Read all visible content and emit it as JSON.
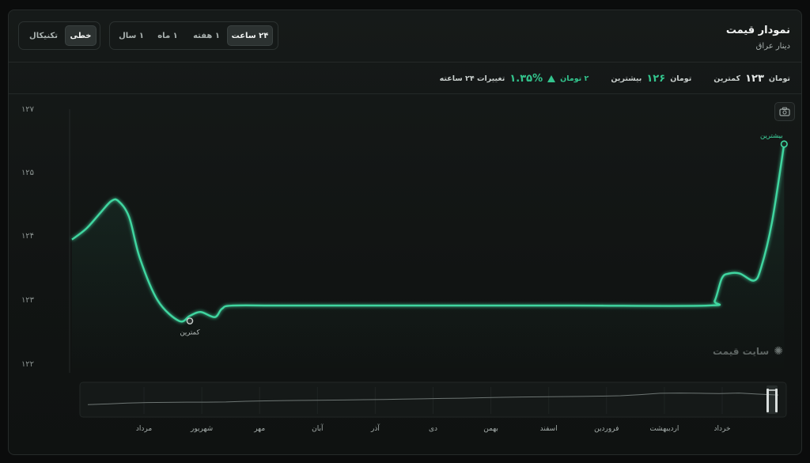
{
  "header": {
    "title": "نمودار قیمت",
    "subtitle": "دینار عراق"
  },
  "range_tabs": [
    {
      "label": "۲۴ ساعت",
      "active": true
    },
    {
      "label": "۱ هفته",
      "active": false
    },
    {
      "label": "۱ ماه",
      "active": false
    },
    {
      "label": "۱ سال",
      "active": false
    }
  ],
  "mode_tabs": [
    {
      "label": "خطی",
      "active": true
    },
    {
      "label": "تکنیکال",
      "active": false
    }
  ],
  "stats": {
    "change_label": "تغییرات ۲۴ ساعته",
    "change_percent": "۱.۳۵%",
    "change_amount": "۲ تومان",
    "max_label": "بیشترین",
    "max_value": "۱۲۶",
    "max_unit": "تومان",
    "min_label": "کمترین",
    "min_value": "۱۲۳",
    "min_unit": "تومان"
  },
  "watermark": "سایت قیمت",
  "icons": {
    "camera": "camera-icon",
    "logo": "logo-icon",
    "change_arrow": "triangle-up-icon"
  },
  "colors": {
    "line": "#3fd6a0",
    "accent_green": "#33c48d",
    "background": "#111413"
  },
  "chart_data": {
    "type": "area",
    "title": "",
    "xlabel": "",
    "ylabel": "",
    "ylim": [
      122,
      127
    ],
    "y_ticks": [
      122,
      123,
      124,
      125,
      127
    ],
    "y_tick_labels": [
      "۱۲۲",
      "۱۲۳",
      "۱۲۴",
      "۱۲۵",
      "۱۲۷"
    ],
    "grid": false,
    "series": [
      {
        "x": [
          0,
          0.02,
          0.04,
          0.055,
          0.065,
          0.08,
          0.095,
          0.12,
          0.15,
          0.165,
          0.18,
          0.2,
          0.21,
          0.225,
          0.3,
          0.5,
          0.7,
          0.89,
          0.9,
          0.91,
          0.92,
          0.935,
          0.955,
          0.965,
          0.98,
          0.997
        ],
        "y": [
          123.93,
          124.1,
          124.35,
          124.53,
          124.53,
          124.28,
          123.64,
          122.98,
          122.66,
          122.74,
          122.8,
          122.72,
          122.85,
          122.9,
          122.9,
          122.9,
          122.9,
          122.9,
          122.98,
          123.33,
          123.4,
          123.4,
          123.29,
          123.5,
          124.2,
          125.42
        ]
      }
    ],
    "annotations": [
      {
        "label": "کمترین",
        "x": 0.165,
        "y": 122.66
      },
      {
        "label": "بیشترین",
        "x": 0.997,
        "y": 125.42
      }
    ],
    "navigator": {
      "months": [
        "مرداد",
        "شهریور",
        "مهر",
        "آبان",
        "آذر",
        "دی",
        "بهمن",
        "اسفند",
        "فروردین",
        "اردیبهشت",
        "خرداد"
      ],
      "values": [
        0.35,
        0.38,
        0.42,
        0.44,
        0.45,
        0.46,
        0.46,
        0.47,
        0.5,
        0.52,
        0.53,
        0.54,
        0.55,
        0.56,
        0.57,
        0.58,
        0.6,
        0.61,
        0.63,
        0.64,
        0.66,
        0.68,
        0.69,
        0.7,
        0.71,
        0.72,
        0.73,
        0.75,
        0.8,
        0.86,
        0.87,
        0.86,
        0.85,
        0.87,
        0.82,
        0.78
      ]
    }
  }
}
